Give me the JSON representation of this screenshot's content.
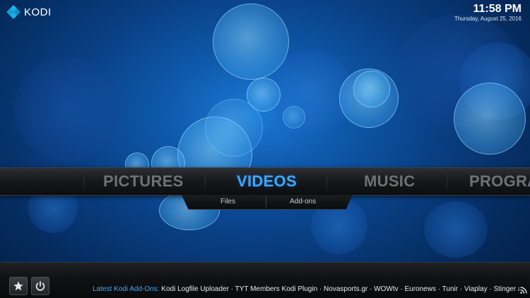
{
  "app": {
    "name": "KODI"
  },
  "clock": {
    "time": "11:58 PM",
    "date": "Thursday, August 25, 2016"
  },
  "main_menu": {
    "items": [
      {
        "label": "PICTURES",
        "active": false
      },
      {
        "label": "VIDEOS",
        "active": true
      },
      {
        "label": "MUSIC",
        "active": false
      },
      {
        "label": "PROGRA",
        "active": false
      }
    ]
  },
  "submenu": {
    "items": [
      {
        "label": "Files"
      },
      {
        "label": "Add-ons"
      }
    ]
  },
  "footer": {
    "favourites_icon": "star-icon",
    "power_icon": "power-icon",
    "ticker_label": "Latest Kodi Add-Ons:",
    "ticker_text": " Kodi Logfile Uploader · TYT Members Kodi Plugin · Novasports.gr · WOWtv · Euronews · Tunir · Viaplay · Stinger a",
    "rss_icon": "rss-icon"
  },
  "colors": {
    "accent": "#3ea7ff",
    "inactive_menu": "#6e7277",
    "logo_blue": "#17b2e7"
  }
}
